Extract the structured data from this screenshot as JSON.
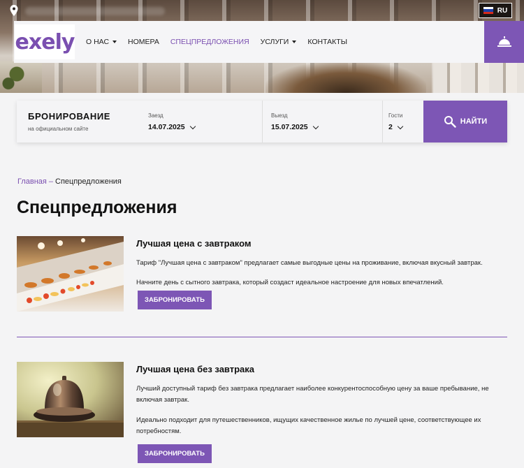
{
  "header": {
    "lang": "RU",
    "logo": "exely",
    "nav": [
      {
        "label": "О НАС",
        "dropdown": true,
        "active": false
      },
      {
        "label": "НОМЕРА",
        "dropdown": false,
        "active": false
      },
      {
        "label": "СПЕЦПРЕДЛОЖЕНИЯ",
        "dropdown": false,
        "active": true
      },
      {
        "label": "УСЛУГИ",
        "dropdown": true,
        "active": false
      },
      {
        "label": "КОНТАКТЫ",
        "dropdown": false,
        "active": false
      }
    ]
  },
  "booking": {
    "title": "БРОНИРОВАНИЕ",
    "subtitle": "на официальном сайте",
    "checkin_label": "Заезд",
    "checkin_value": "14.07.2025",
    "checkout_label": "Выезд",
    "checkout_value": "15.07.2025",
    "guests_label": "Гости",
    "guests_value": "2",
    "find_label": "НАЙТИ"
  },
  "breadcrumb": {
    "home": "Главная",
    "separator": "–",
    "current": "Спецпредложения"
  },
  "page_title": "Спецпредложения",
  "offers": [
    {
      "title": "Лучшая цена с завтраком",
      "p1": "Тариф \"Лучшая цена с завтраком\" предлагает самые выгодные цены на проживание, включая вкусный завтрак.",
      "p2": "Начните день с сытного завтрака, который создаст идеальное настроение для новых впечатлений.",
      "button": "ЗАБРОНИРОВАТЬ"
    },
    {
      "title": "Лучшая цена без завтрака",
      "p1": "Лучший доступный тариф без завтрака предлагает наиболее конкурентоспособную цену за ваше пребывание, не включая завтрак.",
      "p2": "Идеально подходит для путешественников, ищущих качественное жилье по лучшей цене, соответствующее их потребностям.",
      "button": "ЗАБРОНИРОВАТЬ"
    }
  ],
  "colors": {
    "accent": "#7d56b5",
    "brand_text": "#7a4fb0"
  }
}
